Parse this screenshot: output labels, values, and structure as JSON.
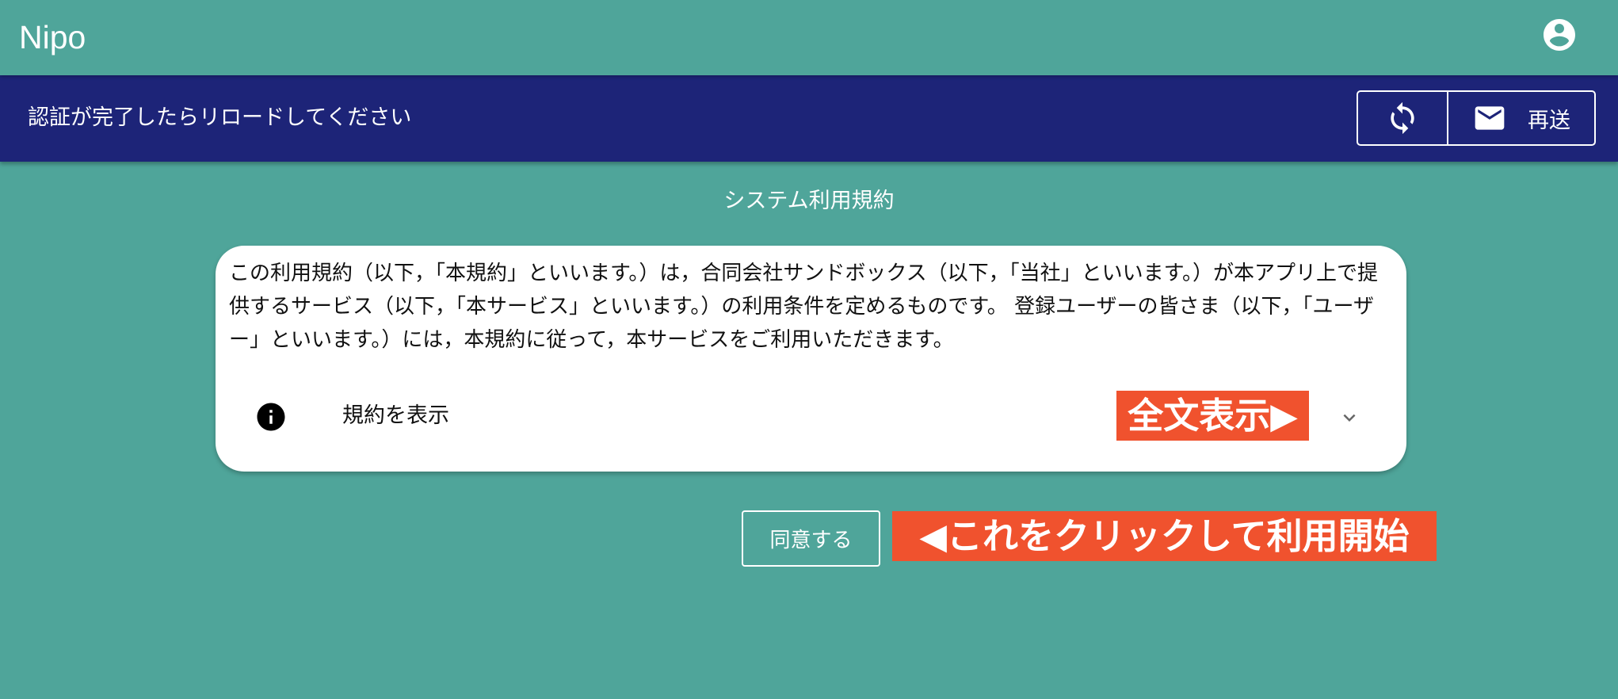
{
  "app_bar": {
    "title": "Nipo",
    "account_icon": "account-circle-icon"
  },
  "banner": {
    "message": "認証が完了したらリロードしてください",
    "reload_icon": "sync-icon",
    "resend_icon": "mail-icon",
    "resend_label": "再送"
  },
  "terms": {
    "section_title": "システム利用規約",
    "body": "この利用規約（以下，「本規約」といいます。）は，合同会社サンドボックス（以下，「当社」といいます。）が本アプリ上で提供するサービス（以下，「本サービス」といいます。）の利用条件を定めるものです。 登録ユーザーの皆さま（以下，「ユーザー」といいます。）には，本規約に従って，本サービスをご利用いただきます。",
    "expand_icon": "info-icon",
    "expand_label": "規約を表示",
    "chevron_icon": "chevron-down-icon"
  },
  "annotations": {
    "show_full_text": "全文表示▶",
    "click_to_start": "◀これをクリックして利用開始"
  },
  "agree_button": {
    "label": "同意する"
  },
  "colors": {
    "background": "#4fa59a",
    "banner": "#1d2478",
    "annotation": "#f0522e",
    "card": "#ffffff"
  }
}
